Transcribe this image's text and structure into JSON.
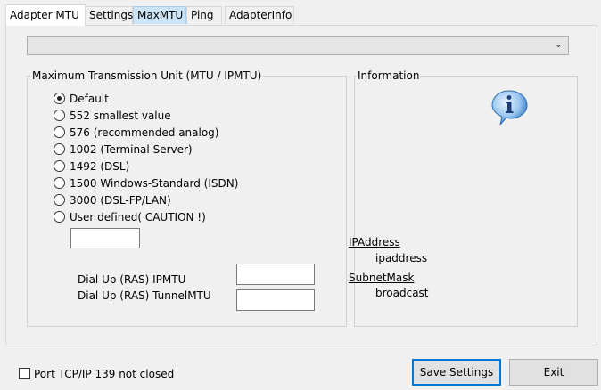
{
  "tabs": [
    {
      "label": "Adapter MTU"
    },
    {
      "label": "Settings"
    },
    {
      "label": "MaxMTU"
    },
    {
      "label": "Ping"
    },
    {
      "label": "AdapterInfo"
    }
  ],
  "adapter_select": {
    "value": ""
  },
  "mtu_group": {
    "title": "Maximum Transmission Unit (MTU / IPMTU)",
    "options": [
      {
        "label": "Default",
        "checked": true
      },
      {
        "label": "552 smallest value",
        "checked": false
      },
      {
        "label": "576 (recommended analog)",
        "checked": false
      },
      {
        "label": "1002 (Terminal Server)",
        "checked": false
      },
      {
        "label": "1492 (DSL)",
        "checked": false
      },
      {
        "label": "1500 Windows-Standard (ISDN)",
        "checked": false
      },
      {
        "label": "3000 (DSL-FP/LAN)",
        "checked": false
      },
      {
        "label": "User defined( CAUTION !)",
        "checked": false
      }
    ],
    "user_defined_value": "",
    "ras_ipmtu_label": "Dial Up (RAS) IPMTU",
    "ras_ipmtu_value": "",
    "ras_tunnelmtu_label": "Dial Up (RAS) TunnelMTU",
    "ras_tunnelmtu_value": ""
  },
  "info_group": {
    "title": "Information",
    "icon": "info-icon",
    "ip_label": "IPAddress ",
    "ip_value": "ipaddress",
    "subnet_label": "SubnetMask",
    "subnet_value": "broadcast"
  },
  "footer": {
    "port_checkbox_label": "Port TCP/IP 139 not closed",
    "port_checkbox_checked": false,
    "save_label": "Save Settings",
    "exit_label": "Exit"
  }
}
